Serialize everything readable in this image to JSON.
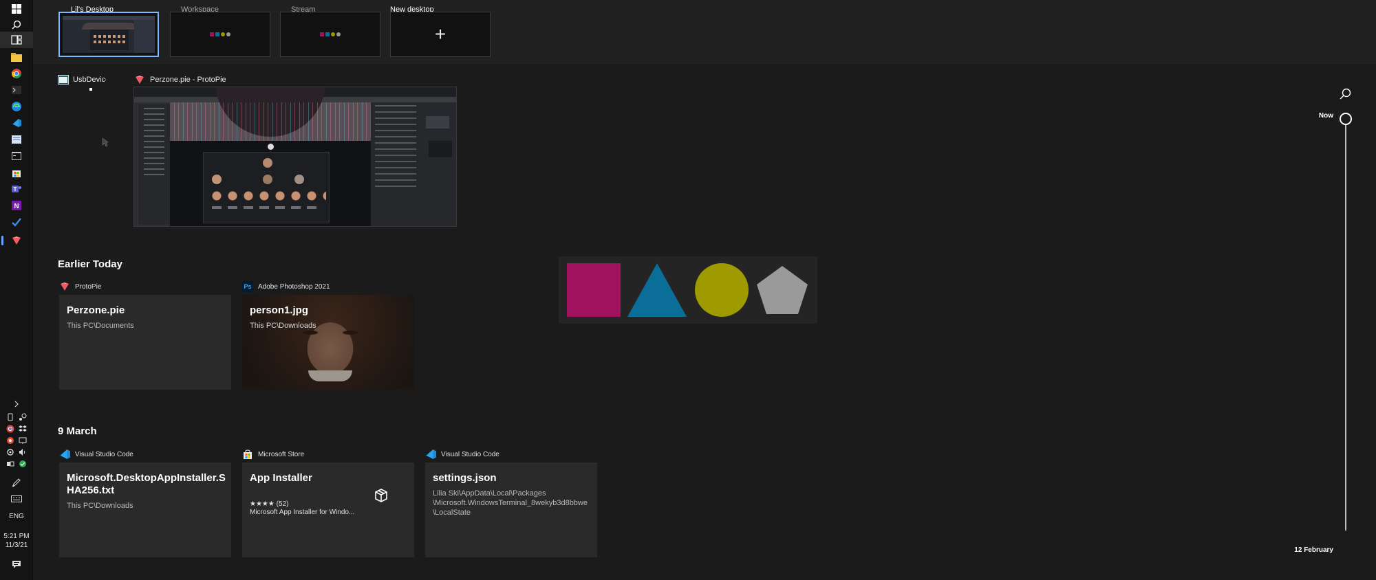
{
  "desktops": {
    "items": [
      {
        "label": "Lil's Desktop",
        "active": true
      },
      {
        "label": "Workspace",
        "active": false
      },
      {
        "label": "Stream",
        "active": false
      },
      {
        "label": "New desktop",
        "active": false
      }
    ],
    "new_desktop_symbol": "+"
  },
  "windows": {
    "items": [
      {
        "title": "UsbDeviceS",
        "icon": "app-window-icon"
      },
      {
        "title": "Perzone.pie - ProtoPie",
        "icon": "protopie-icon"
      }
    ]
  },
  "timeline": {
    "now_label": "Now",
    "bottom_label": "12 February"
  },
  "sections": [
    {
      "heading": "Earlier Today",
      "cards": [
        {
          "app": "ProtoPie",
          "icon": "protopie-icon",
          "title": "Perzone.pie",
          "subtitle": "This PC\\Documents"
        },
        {
          "app": "Adobe Photoshop 2021",
          "icon": "photoshop-icon",
          "app_icon_text": "Ps",
          "title": "person1.jpg",
          "subtitle": "This PC\\Downloads"
        }
      ]
    },
    {
      "heading": "9 March",
      "cards": [
        {
          "app": "Visual Studio Code",
          "icon": "vscode-icon",
          "title": "Microsoft.DesktopAppInstaller.SHA256.txt",
          "subtitle": "This PC\\Downloads"
        },
        {
          "app": "Microsoft Store",
          "icon": "microsoft-store-icon",
          "title": "App Installer",
          "rating": "★★★★ (52)",
          "subtitle": "Microsoft App Installer for Windo..."
        },
        {
          "app": "Visual Studio Code",
          "icon": "vscode-icon",
          "title": "settings.json",
          "subtitle_lines": [
            "Lilia Ski\\AppData\\Local\\Packages",
            "\\Microsoft.WindowsTerminal_8wekyb3d8bbwe",
            "\\LocalState"
          ]
        }
      ]
    }
  ],
  "taskbar": {
    "language": "ENG",
    "time": "5:21 PM",
    "date": "11/3/21"
  },
  "colors": {
    "accent": "#7cb7ff",
    "shape_square": "#a0115e",
    "shape_triangle": "#0b6e98",
    "shape_circle": "#9e9a00",
    "shape_pentagon": "#9a9a9a"
  }
}
